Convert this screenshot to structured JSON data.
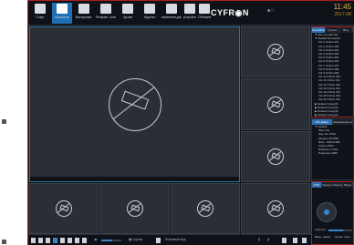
{
  "toolbar": {
    "items": [
      {
        "label": "Старт",
        "icon": "menu-icon"
      },
      {
        "label": "Просмотр",
        "icon": "live-view-icon"
      },
      {
        "label": "Воспроизв.",
        "icon": "playback-icon"
      },
      {
        "label": "Резервн. копия",
        "icon": "backup-icon"
      },
      {
        "label": "Архив",
        "icon": "archive-icon"
      },
      {
        "label": "Журнал",
        "icon": "log-icon"
      },
      {
        "label": "изменени.данн.",
        "icon": "alarm-icon"
      },
      {
        "label": "устройст.настр.",
        "icon": "device-settings-icon"
      },
      {
        "label": "Обновлен.верс.",
        "icon": "settings-icon"
      }
    ],
    "logo": "CYFR◉N",
    "status_text": "■ □",
    "clock_time": "11:45",
    "clock_date": "2017-08"
  },
  "sidebar": {
    "device_tabs": [
      "Устройство",
      "Группа",
      "Вид"
    ],
    "device_tree": [
      "▼ Все устройства",
      "▼ Default Group(24)",
      "CH-1 Online  001",
      "CH-2 Online  002",
      "CH-3 Online  003",
      "CH-4 Online  004",
      "CH-5 Online  005",
      "CH-6 Online  006",
      "CH-7 Online  007",
      "CH-8 Online  008",
      "CH-9 Online  009",
      "CH-10 Online 010",
      "CH-11 Online 011",
      "CH-12 Online 012",
      "CH-13 Online 013",
      "CH-14 Online 014",
      "CH-15 Online 015",
      "CH-16 Online 016",
      "▶ Default Group(6)",
      "▶ Default Group(4)",
      "▶ Default Group(8)",
      "▶ Default Group(2)",
      "▶ Default Group(3)"
    ],
    "info_tabs": [
      "IPC status",
      "Информация канала"
    ],
    "info_rows": [
      "▼ Default",
      "Имя  Ch1",
      "Нау. бит  8192",
      "Модель  IPC888",
      "Фикс.  1920X1080",
      "Frame  25fps",
      "Информ.  H.264",
      "Подписка  4096"
    ],
    "ptz_tabs": [
      "PTZ",
      "Предуст.",
      "Маршрут",
      "Пауза"
    ],
    "ptz_speed_label": "скорость",
    "ptz_buttons": [
      "Ввод. линия",
      "Автом. скан.",
      "Авто"
    ]
  },
  "bottom": {
    "layout_label": "▦ Группа",
    "favorite_label": "Любимый вид",
    "volume_level": 0.55
  },
  "colors": {
    "accent": "#1e6fb3",
    "highlight_border": "#a82020",
    "clock": "#e7b24a"
  }
}
